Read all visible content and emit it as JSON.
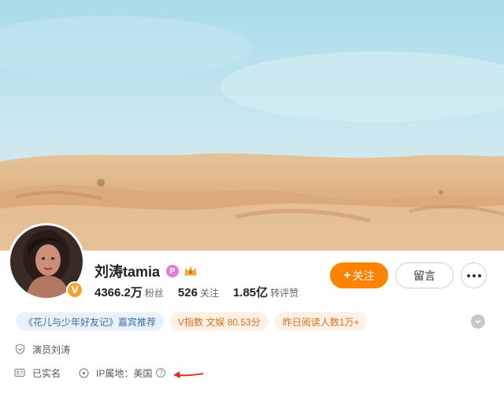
{
  "profile": {
    "name": "刘涛tamia",
    "verified_badge": "V",
    "pink_badge": "P",
    "stats": [
      {
        "value": "4366.2万",
        "label": "粉丝"
      },
      {
        "value": "526",
        "label": "关注"
      },
      {
        "value": "1.85亿",
        "label": "转评赞"
      }
    ]
  },
  "actions": {
    "follow_plus": "+",
    "follow_label": "关注",
    "message_label": "留言"
  },
  "tags": [
    "《花儿与少年好友记》嘉宾推荐",
    "V指数 文娱 80.53分",
    "昨日阅读人数1万+"
  ],
  "info": {
    "title": "演员刘涛",
    "real_name": "已实名",
    "ip_location": "IP属地：美国",
    "help": "?"
  },
  "colors": {
    "accent": "#ff8200",
    "tag_blue_bg": "#e9f1fb",
    "tag_orange_bg": "#fdf1e6",
    "arrow": "#e0322b"
  },
  "icons": [
    "verified-v-icon",
    "pink-badge-icon",
    "gold-crown-icon",
    "more-dots-icon",
    "expand-chevron-icon",
    "shield-icon",
    "id-card-icon",
    "location-pin-icon",
    "question-icon",
    "red-arrow-annotation"
  ]
}
